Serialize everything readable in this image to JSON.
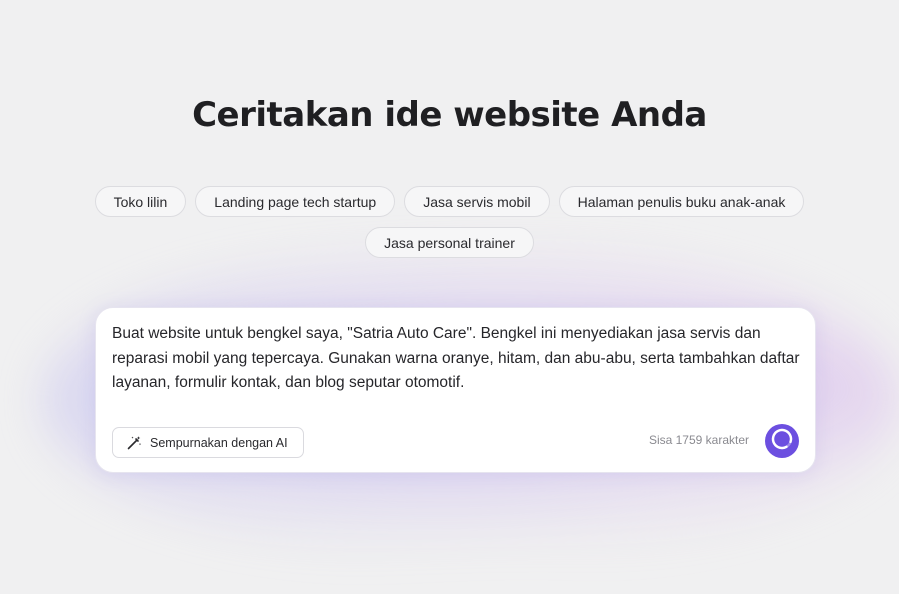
{
  "page": {
    "title": "Ceritakan ide website Anda"
  },
  "suggestions": [
    {
      "label": "Toko lilin"
    },
    {
      "label": "Landing page tech startup"
    },
    {
      "label": "Jasa servis mobil"
    },
    {
      "label": "Halaman penulis buku anak-anak"
    },
    {
      "label": "Jasa personal trainer"
    }
  ],
  "prompt": {
    "value": "Buat website untuk bengkel saya, \"Satria Auto Care\". Bengkel ini menyediakan jasa servis dan reparasi mobil yang tepercaya. Gunakan warna oranye, hitam, dan abu-abu, serta tambahkan daftar layanan, formulir kontak, dan blog seputar otomotif.",
    "refine_label": "Sempurnakan dengan AI",
    "refine_icon": "magic-wand-icon",
    "char_count": "Sisa 1759 karakter",
    "submit_icon": "progress-ring-icon",
    "remaining_fraction": 0.88
  },
  "colors": {
    "accent": "#6c4fe0",
    "background": "#f0f0f1"
  }
}
